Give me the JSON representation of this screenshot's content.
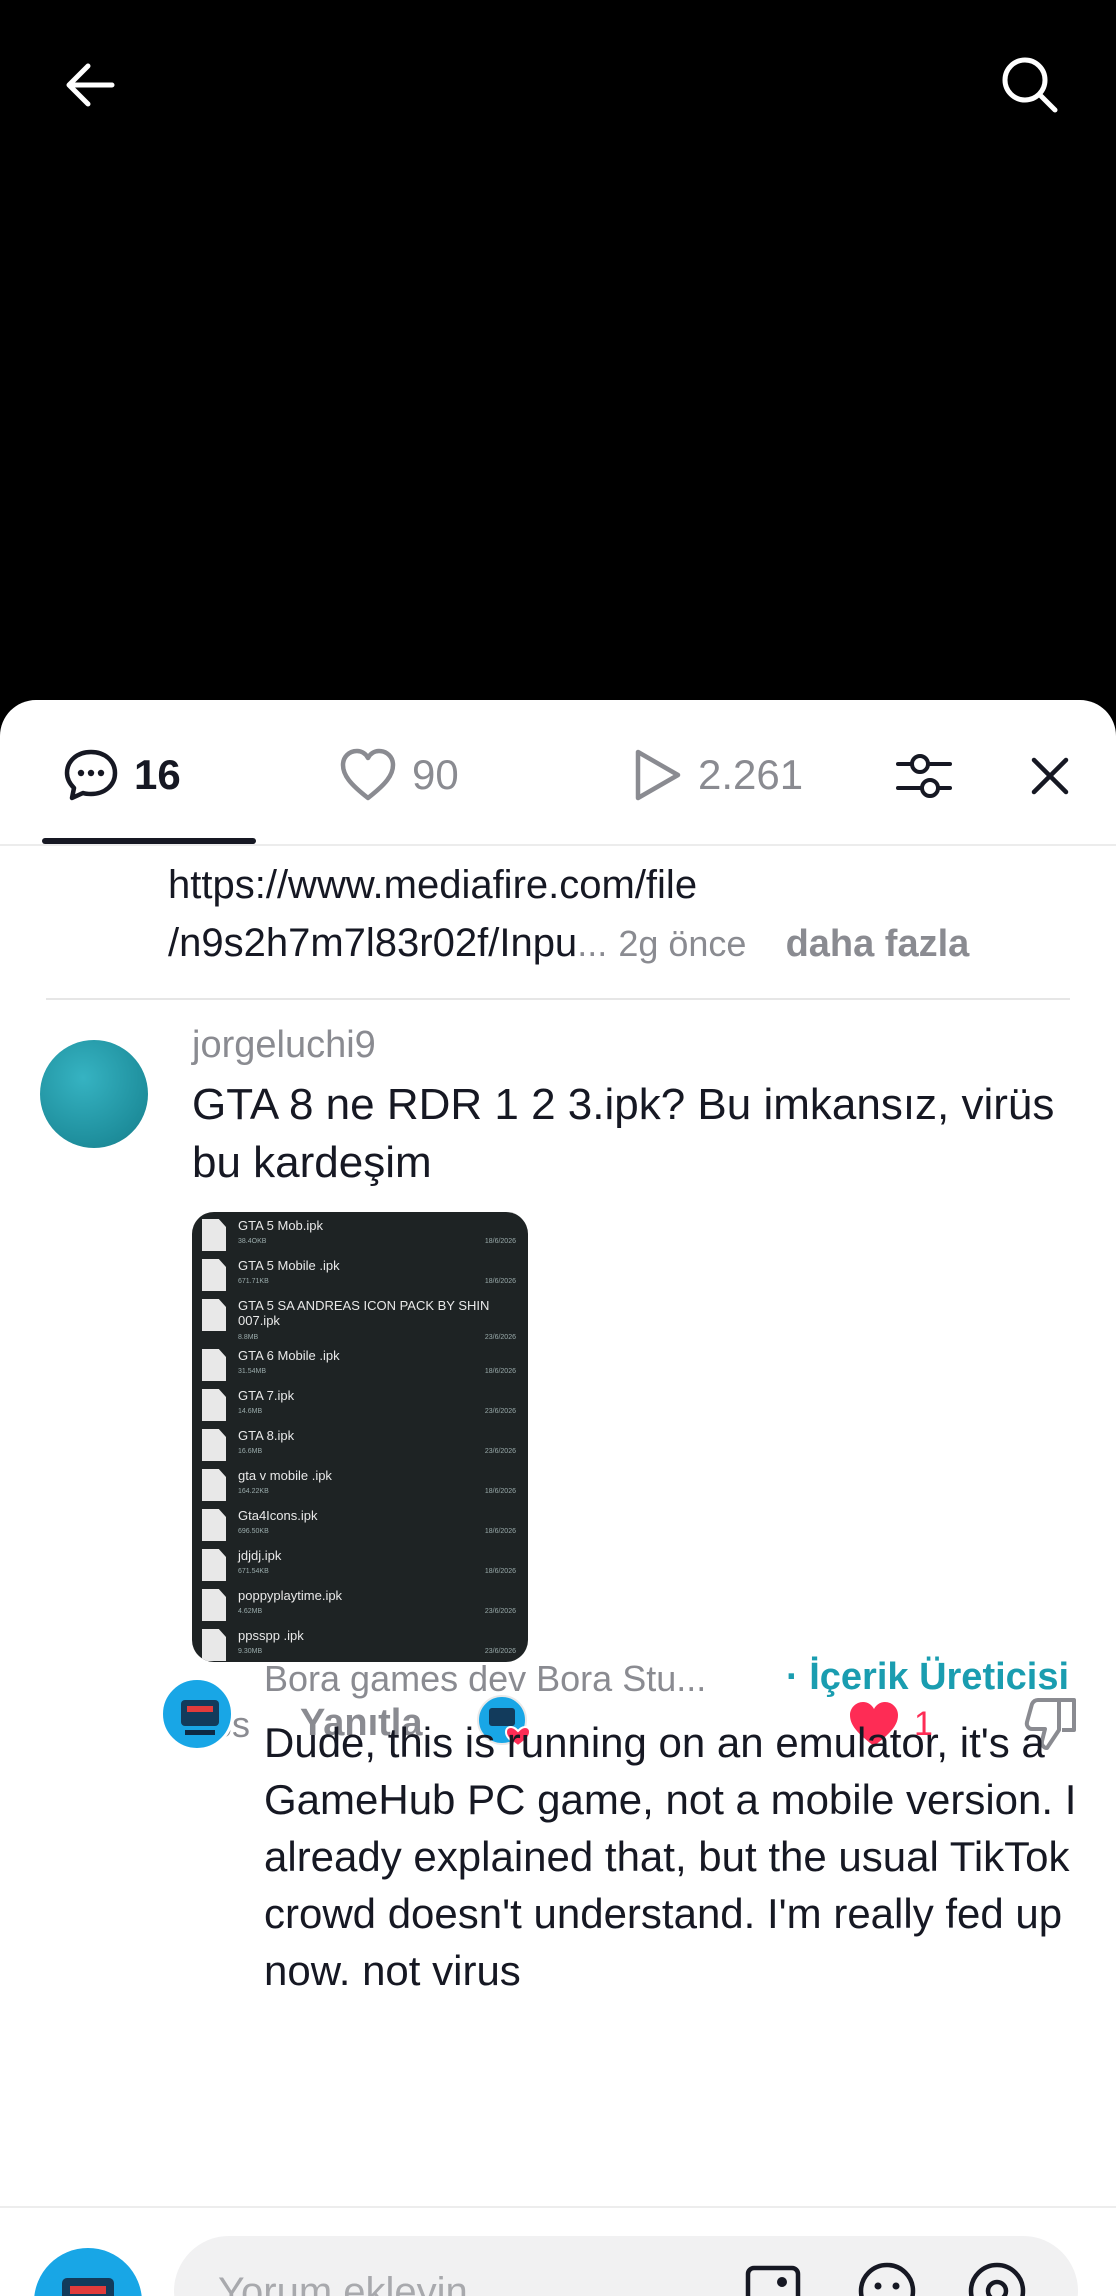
{
  "tabs": {
    "comments_count": "16",
    "likes_count": "90",
    "views_count": "2.261"
  },
  "previous_comment": {
    "url_line1": "https://www.mediafire.com/file",
    "url_line2": "/n9s2h7m7l83r02f/Inpu",
    "ellipsis": "...",
    "time": "2g önce",
    "more": "daha fazla"
  },
  "comment": {
    "username": "jorgeluchi9",
    "text": "GTA 8 ne RDR 1 2 3.ipk? Bu imkansız, virüs bu kardeşim",
    "time": "18s",
    "reply_label": "Yanıtla",
    "like_count": "1",
    "files": [
      {
        "name": "GTA 5 Mob.ipk",
        "size": "38.4OKB",
        "date": "18/6/2026"
      },
      {
        "name": "GTA 5 Mobile .ipk",
        "size": "671.71KB",
        "date": "18/6/2026"
      },
      {
        "name": "GTA 5 SA ANDREAS ICON PACK BY SHIN 007.ipk",
        "size": "8.8MB",
        "date": "23/6/2026"
      },
      {
        "name": "GTA 6 Mobile .ipk",
        "size": "31.54MB",
        "date": "18/6/2026"
      },
      {
        "name": "GTA 7.ipk",
        "size": "14.6MB",
        "date": "23/6/2026"
      },
      {
        "name": "GTA 8.ipk",
        "size": "16.6MB",
        "date": "23/6/2026"
      },
      {
        "name": "gta v mobile .ipk",
        "size": "164.22KB",
        "date": "18/6/2026"
      },
      {
        "name": "Gta4Icons.ipk",
        "size": "696.50KB",
        "date": "18/6/2026"
      },
      {
        "name": "jdjdj.ipk",
        "size": "671.54KB",
        "date": "18/6/2026"
      },
      {
        "name": "poppyplaytime.ipk",
        "size": "4.62MB",
        "date": "23/6/2026"
      },
      {
        "name": "ppsspp .ipk",
        "size": "9.30MB",
        "date": "23/6/2026"
      }
    ]
  },
  "reply": {
    "username": "Bora games dev Bora Stu...",
    "creator_tag": "· İçerik Üreticisi",
    "text": "Dude, this is running on an emulator, it's a GameHub PC game, not a mobile version. I already explained that, but the usual TikTok crowd doesn't understand. I'm really fed up now. not virus"
  },
  "composer": {
    "placeholder": "Yorum ekleyin..."
  },
  "colors": {
    "accent_red": "#fe2c55",
    "creator_teal": "#1a9db0",
    "text_dark": "#161823",
    "text_gray": "#8a8b91"
  },
  "icons": [
    "back-arrow-icon",
    "search-icon",
    "comment-bubble-icon",
    "heart-icon",
    "play-icon",
    "filter-sliders-icon",
    "close-icon",
    "dislike-icon",
    "image-icon",
    "emoji-icon",
    "at-icon"
  ]
}
